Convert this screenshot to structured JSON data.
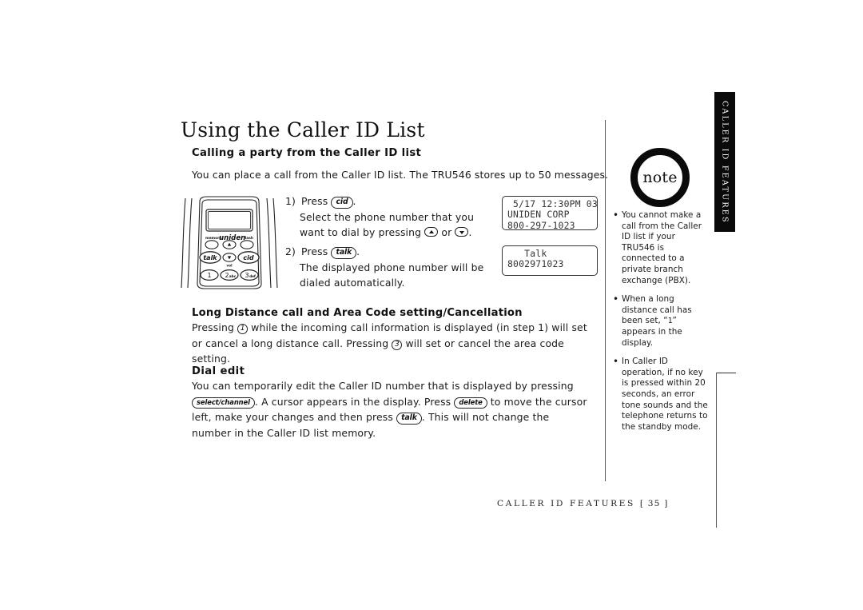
{
  "page": {
    "title": "Using the Caller ID List",
    "footer_section": "CALLER ID FEATURES",
    "footer_page": "[ 35 ]",
    "side_tab": "CALLER ID FEATURES"
  },
  "sections": {
    "calling": {
      "heading": "Calling a party from the Caller ID list",
      "intro": "You can place a call from the Caller ID list. The TRU546 stores up to 50 messages.",
      "steps": [
        {
          "number": "1)",
          "lead_before": "Press",
          "key": "cid",
          "lead_after": ".",
          "body_1": "Select the phone number that you",
          "body_2_a": "want to dial by pressing",
          "body_2_or": "or",
          "body_2_end": "."
        },
        {
          "number": "2)",
          "lead_before": "Press",
          "key": "talk",
          "lead_after": ".",
          "body_1": "The displayed phone number will be",
          "body_2": "dialed automatically."
        }
      ]
    },
    "long_distance": {
      "heading": "Long Distance call and Area Code setting/Cancellation",
      "text_a": "Pressing",
      "key_1": "1",
      "text_b": "while the incoming call information is displayed (in step 1) will set or cancel a long distance call. Pressing",
      "key_3": "3",
      "text_c": "will set or cancel the area code setting."
    },
    "dial_edit": {
      "heading": "Dial edit",
      "text_a": "You can temporarily edit the Caller ID number that is displayed by pressing",
      "key_select": "select/channel",
      "text_b": ". A cursor appears in the display. Press",
      "key_delete": "delete",
      "text_c": "to move the cursor left, make your changes and then press",
      "key_talk": "talk",
      "text_d": ". This will not change the number in the Caller ID list memory."
    }
  },
  "lcd_displays": [
    {
      "name": "caller-id-display",
      "line1": " 5/17 12:30PM 03",
      "line2": "UNIDEN CORP",
      "line3": "800-297-1023"
    },
    {
      "name": "talk-display",
      "line1": "   Talk",
      "line2": "8002971023"
    }
  ],
  "note": {
    "badge_label": "note",
    "items": [
      {
        "text": "You cannot make a call from the Caller ID list if your TRU546 is connected to a private branch exchange (PBX)."
      },
      {
        "text_a": "When a long distance call has been set, “",
        "mono": "1",
        "text_b": "” appears in the display."
      },
      {
        "text": "In Caller ID operation, if no key is pressed within 20 seconds, an error tone sounds and the telephone returns to the standby mode."
      }
    ]
  },
  "phone_illustration": {
    "brand": "uniden",
    "label_memory": "memory",
    "label_flash": "flash",
    "label_vol": "vol",
    "button_talk": "talk",
    "button_cid": "cid",
    "key_1": "1",
    "key_2": "2",
    "key_2_sub": "abc",
    "key_3": "3",
    "key_3_sub": "def"
  },
  "colors": {
    "ink": "#1a1a1a",
    "tab_background": "#0a0a0a",
    "tab_text": "#ffffff",
    "rule": "#555555"
  }
}
